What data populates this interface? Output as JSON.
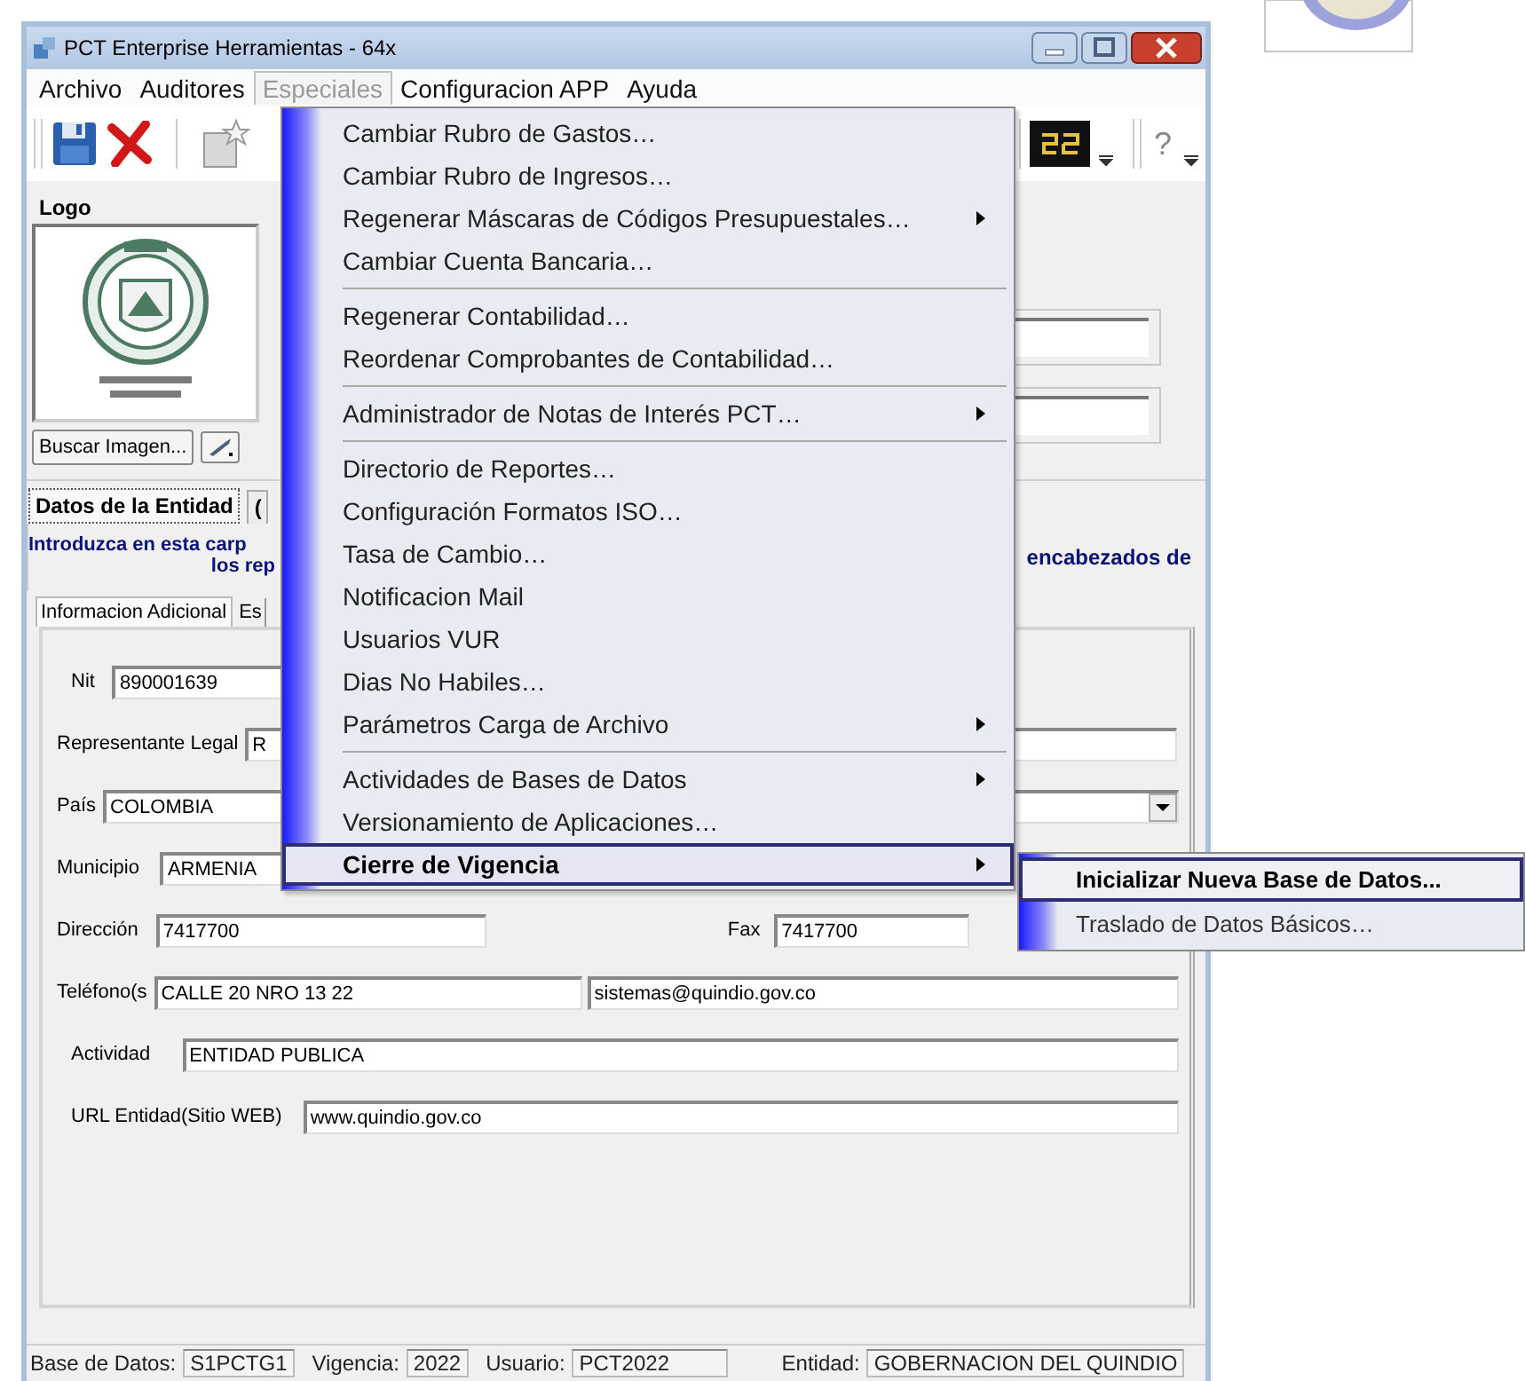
{
  "window": {
    "title": "PCT Enterprise Herramientas - 64x"
  },
  "menubar": [
    {
      "label": "Archivo",
      "selected": false
    },
    {
      "label": "Auditores",
      "selected": false
    },
    {
      "label": "Especiales",
      "selected": true
    },
    {
      "label": "Configuracion APP",
      "selected": false
    },
    {
      "label": "Ayuda",
      "selected": false
    }
  ],
  "toolbar": {
    "help_label": "?"
  },
  "logo_panel": {
    "title": "Logo",
    "browse_button": "Buscar Imagen..."
  },
  "tabs": [
    {
      "label": "Datos de la Entidad",
      "selected": true
    },
    {
      "label": "(",
      "selected": false
    }
  ],
  "intro": {
    "line_1": "Introduzca en esta carp",
    "line_2": "los rep",
    "right_fragment": "encabezados de"
  },
  "subtabs": [
    {
      "label": "Informacion Adicional",
      "selected": true
    },
    {
      "label": "Es",
      "selected": false
    }
  ],
  "form_rows": [
    {
      "fields": [
        {
          "label": "Nit",
          "value": "890001639",
          "kind": "text"
        }
      ]
    },
    {
      "fields": [
        {
          "label": "Representante Legal",
          "value": "R",
          "kind": "text"
        }
      ]
    },
    {
      "fields": [
        {
          "label": "País",
          "value": "COLOMBIA",
          "kind": "combo"
        }
      ]
    },
    {
      "fields": [
        {
          "label": "Municipio",
          "value": "ARMENIA",
          "kind": "text"
        }
      ]
    },
    {
      "fields": [
        {
          "label": "Dirección",
          "value": "7417700",
          "kind": "text"
        },
        {
          "label": "Fax",
          "value": "7417700",
          "kind": "text"
        }
      ]
    },
    {
      "fields": [
        {
          "label": "Teléfono(s",
          "value": "CALLE 20 NRO 13 22",
          "kind": "text"
        },
        {
          "value": "sistemas@quindio.gov.co",
          "kind": "text"
        }
      ]
    },
    {
      "fields": [
        {
          "label": "Actividad",
          "value": "ENTIDAD PUBLICA",
          "kind": "text"
        }
      ]
    },
    {
      "fields": [
        {
          "label": "URL Entidad(Sitio WEB)",
          "value": "www.quindio.gov.co",
          "kind": "text"
        }
      ]
    }
  ],
  "status_bar": [
    {
      "label": "Base de Datos:",
      "value": "S1PCTG1"
    },
    {
      "label": "Vigencia:",
      "value": "2022"
    },
    {
      "label": "Usuario:",
      "value": "PCT2022"
    },
    {
      "label": "Entidad:",
      "value": "GOBERNACION DEL QUINDIO"
    }
  ],
  "especiales_menu": [
    {
      "kind": "item",
      "label": "Cambiar Rubro de Gastos…",
      "submenu": false,
      "selected": false
    },
    {
      "kind": "item",
      "label": "Cambiar Rubro de Ingresos…",
      "submenu": false,
      "selected": false
    },
    {
      "kind": "item",
      "label": "Regenerar Máscaras de Códigos Presupuestales…",
      "submenu": true,
      "selected": false
    },
    {
      "kind": "item",
      "label": "Cambiar Cuenta Bancaria…",
      "submenu": false,
      "selected": false
    },
    {
      "kind": "separator"
    },
    {
      "kind": "item",
      "label": "Regenerar Contabilidad…",
      "submenu": false,
      "selected": false
    },
    {
      "kind": "item",
      "label": "Reordenar Comprobantes de Contabilidad…",
      "submenu": false,
      "selected": false
    },
    {
      "kind": "separator"
    },
    {
      "kind": "item",
      "label": "Administrador de Notas de Interés PCT…",
      "submenu": true,
      "selected": false
    },
    {
      "kind": "separator"
    },
    {
      "kind": "item",
      "label": "Directorio de Reportes…",
      "submenu": false,
      "selected": false
    },
    {
      "kind": "item",
      "label": "Configuración Formatos ISO…",
      "submenu": false,
      "selected": false
    },
    {
      "kind": "item",
      "label": "Tasa de Cambio…",
      "submenu": false,
      "selected": false
    },
    {
      "kind": "item",
      "label": "Notificacion Mail",
      "submenu": false,
      "selected": false
    },
    {
      "kind": "item",
      "label": "Usuarios VUR",
      "submenu": false,
      "selected": false
    },
    {
      "kind": "item",
      "label": "Dias No Habiles…",
      "submenu": false,
      "selected": false
    },
    {
      "kind": "item",
      "label": "Parámetros Carga de Archivo",
      "submenu": true,
      "selected": false
    },
    {
      "kind": "separator"
    },
    {
      "kind": "item",
      "label": "Actividades de Bases de Datos",
      "submenu": true,
      "selected": false
    },
    {
      "kind": "item",
      "label": "Versionamiento de Aplicaciones…",
      "submenu": false,
      "selected": false
    },
    {
      "kind": "item",
      "label": "Cierre de Vigencia",
      "submenu": true,
      "selected": true
    }
  ],
  "cierre_submenu": [
    {
      "label": "Inicializar Nueva Base de Datos...",
      "selected": true
    },
    {
      "label": "Traslado de Datos Básicos…",
      "selected": false
    }
  ]
}
